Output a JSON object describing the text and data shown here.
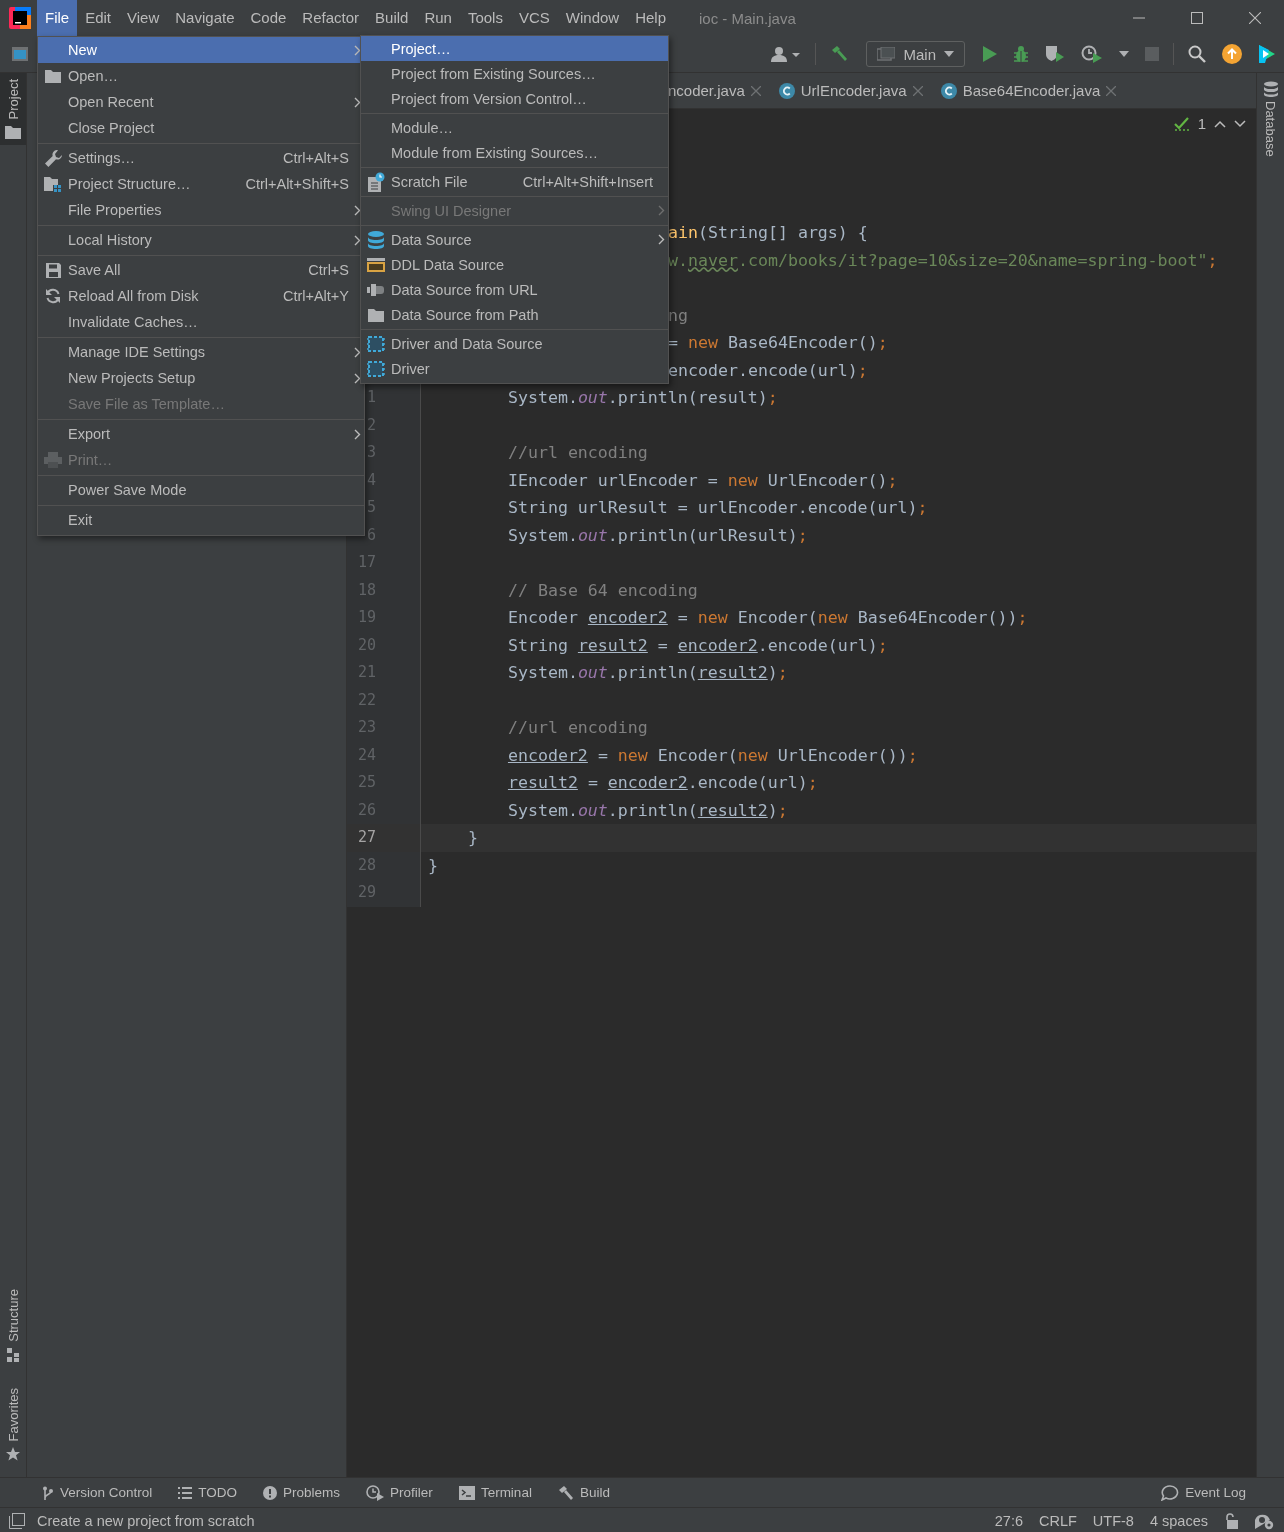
{
  "menu_bar": {
    "items": [
      {
        "label": "File",
        "selected": true
      },
      {
        "label": "Edit",
        "selected": false
      },
      {
        "label": "View",
        "selected": false
      },
      {
        "label": "Navigate",
        "selected": false
      },
      {
        "label": "Code",
        "selected": false
      },
      {
        "label": "Refactor",
        "selected": false
      },
      {
        "label": "Build",
        "selected": false
      },
      {
        "label": "Run",
        "selected": false
      },
      {
        "label": "Tools",
        "selected": false
      },
      {
        "label": "VCS",
        "selected": false
      },
      {
        "label": "Window",
        "selected": false
      },
      {
        "label": "Help",
        "selected": false
      }
    ],
    "title": "ioc - Main.java"
  },
  "toolbar": {
    "run_config": "Main"
  },
  "left_strip": {
    "tabs": [
      {
        "label": "Project",
        "selected": true
      },
      {
        "label": "Structure",
        "selected": false
      },
      {
        "label": "Favorites",
        "selected": false
      }
    ]
  },
  "editor": {
    "tabs": [
      {
        "label": "ncoder.java",
        "clipped": true
      },
      {
        "label": "UrlEncoder.java",
        "clipped": false
      },
      {
        "label": "Base64Encoder.java",
        "clipped": false
      }
    ],
    "inspection": {
      "count": "1"
    },
    "lines": [
      {
        "current": false,
        "clipped": true,
        "tokens": [
          {
            "text": "ain",
            "kind": "method"
          },
          {
            "text": "(String[] args) {",
            "kind": "plain"
          }
        ]
      },
      {
        "current": false,
        "clipped": true,
        "tokens": [
          {
            "text": "w.",
            "kind": "string"
          },
          {
            "text": "naver",
            "kind": "typo"
          },
          {
            "text": ".com/books/it?page=10&size=20&name=spring-boot\"",
            "kind": "string"
          },
          {
            "text": ";",
            "kind": "punct"
          }
        ]
      },
      {
        "current": false,
        "clipped": true,
        "tokens": [
          {
            "text": "ng",
            "kind": "comment"
          }
        ]
      },
      {
        "current": false,
        "clipped": true,
        "tokens": [
          {
            "text": "= ",
            "kind": "plain"
          },
          {
            "text": "new",
            "kind": "keyword"
          },
          {
            "text": " Base64Encoder()",
            "kind": "plain"
          },
          {
            "text": ";",
            "kind": "punct"
          }
        ]
      },
      {
        "current": false,
        "clipped": true,
        "tokens": [
          {
            "text": "encoder.encode(url)",
            "kind": "plain"
          },
          {
            "text": ";",
            "kind": "punct"
          }
        ]
      },
      {
        "number": "1",
        "current": false,
        "tokens": [
          {
            "text": "        System.",
            "kind": "plain"
          },
          {
            "text": "out",
            "kind": "field"
          },
          {
            "text": ".println(result)",
            "kind": "plain"
          },
          {
            "text": ";",
            "kind": "punct"
          }
        ]
      },
      {
        "number": "2",
        "current": false
      },
      {
        "number": "3",
        "current": false,
        "tokens": [
          {
            "text": "        //url encoding",
            "kind": "comment"
          }
        ]
      },
      {
        "number": "4",
        "current": false,
        "tokens": [
          {
            "text": "        IEncoder urlEncoder = ",
            "kind": "plain"
          },
          {
            "text": "new",
            "kind": "keyword"
          },
          {
            "text": " UrlEncoder()",
            "kind": "plain"
          },
          {
            "text": ";",
            "kind": "punct"
          }
        ]
      },
      {
        "number": "5",
        "current": false,
        "tokens": [
          {
            "text": "        String urlResult = urlEncoder.encode(url)",
            "kind": "plain"
          },
          {
            "text": ";",
            "kind": "punct"
          }
        ]
      },
      {
        "number": "6",
        "current": false,
        "tokens": [
          {
            "text": "        System.",
            "kind": "plain"
          },
          {
            "text": "out",
            "kind": "field"
          },
          {
            "text": ".println(urlResult)",
            "kind": "plain"
          },
          {
            "text": ";",
            "kind": "punct"
          }
        ]
      },
      {
        "number": "17",
        "current": false
      },
      {
        "number": "18",
        "current": false,
        "tokens": [
          {
            "text": "        // Base 64 encoding",
            "kind": "comment"
          }
        ]
      },
      {
        "number": "19",
        "current": false,
        "tokens": [
          {
            "text": "        Encoder ",
            "kind": "plain"
          },
          {
            "text": "encoder2",
            "kind": "reassigned"
          },
          {
            "text": " = ",
            "kind": "plain"
          },
          {
            "text": "new",
            "kind": "keyword"
          },
          {
            "text": " Encoder(",
            "kind": "plain"
          },
          {
            "text": "new",
            "kind": "keyword"
          },
          {
            "text": " Base64Encoder())",
            "kind": "plain"
          },
          {
            "text": ";",
            "kind": "punct"
          }
        ]
      },
      {
        "number": "20",
        "current": false,
        "tokens": [
          {
            "text": "        String ",
            "kind": "plain"
          },
          {
            "text": "result2",
            "kind": "reassigned"
          },
          {
            "text": " = ",
            "kind": "plain"
          },
          {
            "text": "encoder2",
            "kind": "reassigned"
          },
          {
            "text": ".encode(url)",
            "kind": "plain"
          },
          {
            "text": ";",
            "kind": "punct"
          }
        ]
      },
      {
        "number": "21",
        "current": false,
        "tokens": [
          {
            "text": "        System.",
            "kind": "plain"
          },
          {
            "text": "out",
            "kind": "field"
          },
          {
            "text": ".println(",
            "kind": "plain"
          },
          {
            "text": "result2",
            "kind": "reassigned"
          },
          {
            "text": ")",
            "kind": "plain"
          },
          {
            "text": ";",
            "kind": "punct"
          }
        ]
      },
      {
        "number": "22",
        "current": false
      },
      {
        "number": "23",
        "current": false,
        "tokens": [
          {
            "text": "        //url encoding",
            "kind": "comment"
          }
        ]
      },
      {
        "number": "24",
        "current": false,
        "tokens": [
          {
            "text": "        encoder2",
            "kind": "reassigned"
          },
          {
            "text": " = ",
            "kind": "plain"
          },
          {
            "text": "new",
            "kind": "keyword"
          },
          {
            "text": " Encoder(",
            "kind": "plain"
          },
          {
            "text": "new",
            "kind": "keyword"
          },
          {
            "text": " UrlEncoder())",
            "kind": "plain"
          },
          {
            "text": ";",
            "kind": "punct"
          }
        ]
      },
      {
        "number": "25",
        "current": false,
        "tokens": [
          {
            "text": "        result2",
            "kind": "reassigned"
          },
          {
            "text": " = ",
            "kind": "plain"
          },
          {
            "text": "encoder2",
            "kind": "reassigned"
          },
          {
            "text": ".encode(url)",
            "kind": "plain"
          },
          {
            "text": ";",
            "kind": "punct"
          }
        ]
      },
      {
        "number": "26",
        "current": false,
        "tokens": [
          {
            "text": "        System.",
            "kind": "plain"
          },
          {
            "text": "out",
            "kind": "field"
          },
          {
            "text": ".println(",
            "kind": "plain"
          },
          {
            "text": "result2",
            "kind": "reassigned"
          },
          {
            "text": ")",
            "kind": "plain"
          },
          {
            "text": ";",
            "kind": "punct"
          }
        ]
      },
      {
        "number": "27",
        "current": true,
        "tokens": [
          {
            "text": "    }",
            "kind": "plain"
          }
        ]
      },
      {
        "number": "28",
        "current": false,
        "tokens": [
          {
            "text": "}",
            "kind": "plain"
          }
        ]
      },
      {
        "number": "29",
        "current": false
      }
    ]
  },
  "right_strip": {
    "tabs": [
      {
        "label": "Database"
      }
    ]
  },
  "file_menu": {
    "items": [
      {
        "kind": "item",
        "label": "New",
        "selected": true,
        "disabled": false,
        "submenu": true
      },
      {
        "kind": "item",
        "label": "Open…",
        "selected": false,
        "disabled": false,
        "submenu": false
      },
      {
        "kind": "item",
        "label": "Open Recent",
        "selected": false,
        "disabled": false,
        "submenu": true
      },
      {
        "kind": "item",
        "label": "Close Project",
        "selected": false,
        "disabled": false,
        "submenu": false
      },
      {
        "kind": "separator"
      },
      {
        "kind": "item",
        "label": "Settings…",
        "shortcut": "Ctrl+Alt+S",
        "selected": false,
        "disabled": false,
        "submenu": false
      },
      {
        "kind": "item",
        "label": "Project Structure…",
        "shortcut": "Ctrl+Alt+Shift+S",
        "selected": false,
        "disabled": false,
        "submenu": false
      },
      {
        "kind": "item",
        "label": "File Properties",
        "selected": false,
        "disabled": false,
        "submenu": true
      },
      {
        "kind": "separator"
      },
      {
        "kind": "item",
        "label": "Local History",
        "selected": false,
        "disabled": false,
        "submenu": true
      },
      {
        "kind": "separator"
      },
      {
        "kind": "item",
        "label": "Save All",
        "shortcut": "Ctrl+S",
        "selected": false,
        "disabled": false,
        "submenu": false
      },
      {
        "kind": "item",
        "label": "Reload All from Disk",
        "shortcut": "Ctrl+Alt+Y",
        "selected": false,
        "disabled": false,
        "submenu": false
      },
      {
        "kind": "item",
        "label": "Invalidate Caches…",
        "selected": false,
        "disabled": false,
        "submenu": false
      },
      {
        "kind": "separator"
      },
      {
        "kind": "item",
        "label": "Manage IDE Settings",
        "selected": false,
        "disabled": false,
        "submenu": true
      },
      {
        "kind": "item",
        "label": "New Projects Setup",
        "selected": false,
        "disabled": false,
        "submenu": true
      },
      {
        "kind": "item",
        "label": "Save File as Template…",
        "selected": false,
        "disabled": true,
        "submenu": false
      },
      {
        "kind": "separator"
      },
      {
        "kind": "item",
        "label": "Export",
        "selected": false,
        "disabled": false,
        "submenu": true
      },
      {
        "kind": "item",
        "label": "Print…",
        "selected": false,
        "disabled": true,
        "submenu": false
      },
      {
        "kind": "separator"
      },
      {
        "kind": "item",
        "label": "Power Save Mode",
        "selected": false,
        "disabled": false,
        "submenu": false
      },
      {
        "kind": "separator"
      },
      {
        "kind": "item",
        "label": "Exit",
        "selected": false,
        "disabled": false,
        "submenu": false
      }
    ]
  },
  "new_submenu": {
    "items": [
      {
        "kind": "item",
        "label": "Project…",
        "selected": true,
        "disabled": false,
        "submenu": false
      },
      {
        "kind": "item",
        "label": "Project from Existing Sources…",
        "selected": false,
        "disabled": false,
        "submenu": false
      },
      {
        "kind": "item",
        "label": "Project from Version Control…",
        "selected": false,
        "disabled": false,
        "submenu": false
      },
      {
        "kind": "separator"
      },
      {
        "kind": "item",
        "label": "Module…",
        "selected": false,
        "disabled": false,
        "submenu": false
      },
      {
        "kind": "item",
        "label": "Module from Existing Sources…",
        "selected": false,
        "disabled": false,
        "submenu": false
      },
      {
        "kind": "separator"
      },
      {
        "kind": "item",
        "label": "Scratch File",
        "shortcut": "Ctrl+Alt+Shift+Insert",
        "selected": false,
        "disabled": false,
        "submenu": false
      },
      {
        "kind": "separator"
      },
      {
        "kind": "item",
        "label": "Swing UI Designer",
        "selected": false,
        "disabled": true,
        "submenu": true
      },
      {
        "kind": "separator"
      },
      {
        "kind": "item",
        "label": "Data Source",
        "selected": false,
        "disabled": false,
        "submenu": true
      },
      {
        "kind": "item",
        "label": "DDL Data Source",
        "selected": false,
        "disabled": false,
        "submenu": false
      },
      {
        "kind": "item",
        "label": "Data Source from URL",
        "selected": false,
        "disabled": false,
        "submenu": false
      },
      {
        "kind": "item",
        "label": "Data Source from Path",
        "selected": false,
        "disabled": false,
        "submenu": false
      },
      {
        "kind": "separator"
      },
      {
        "kind": "item",
        "label": "Driver and Data Source",
        "selected": false,
        "disabled": false,
        "submenu": false
      },
      {
        "kind": "item",
        "label": "Driver",
        "selected": false,
        "disabled": false,
        "submenu": false
      }
    ]
  },
  "tool_windows": [
    "Version Control",
    "TODO",
    "Problems",
    "Profiler",
    "Terminal",
    "Build"
  ],
  "event_log": "Event Log",
  "status_bar": {
    "message": "Create a new project from scratch",
    "items": [
      "27:6",
      "CRLF",
      "UTF-8",
      "4 spaces"
    ]
  }
}
